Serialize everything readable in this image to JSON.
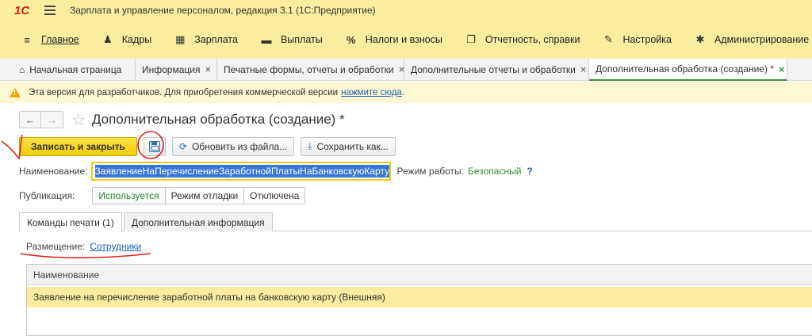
{
  "window": {
    "logo": "1С",
    "title": "Зарплата и управление персоналом, редакция 3.1  (1С:Предприятие)"
  },
  "sections": [
    {
      "icon": "menu-lines-icon",
      "glyph": "≡",
      "label": "Главное"
    },
    {
      "icon": "people-icon",
      "glyph": "♟",
      "label": "Кадры"
    },
    {
      "icon": "calculator-icon",
      "glyph": "▦",
      "label": "Зарплата"
    },
    {
      "icon": "wallet-icon",
      "glyph": "▬",
      "label": "Выплаты"
    },
    {
      "icon": "percent-icon",
      "glyph": "%",
      "label": "Налоги и взносы"
    },
    {
      "icon": "report-icon",
      "glyph": "❐",
      "label": "Отчетность, справки"
    },
    {
      "icon": "wrench-icon",
      "glyph": "✎",
      "label": "Настройка"
    },
    {
      "icon": "gear-icon",
      "glyph": "✱",
      "label": "Администрирование"
    }
  ],
  "tabs": [
    {
      "label": "Начальная страница",
      "closable": false
    },
    {
      "label": "Информация",
      "closable": true
    },
    {
      "label": "Печатные формы, отчеты и обработки",
      "closable": true
    },
    {
      "label": "Дополнительные отчеты и обработки",
      "closable": true
    },
    {
      "label": "Дополнительная обработка (создание) *",
      "closable": true
    }
  ],
  "banner": {
    "text": "Эта версия для разработчиков. Для приобретения коммерческой версии",
    "link": "нажмите сюда",
    "tail": "."
  },
  "form": {
    "title": "Дополнительная обработка (создание) *",
    "buttons": {
      "save_close": "Записать и закрыть",
      "update_from_file": "Обновить из файла...",
      "save_as": "Сохранить как..."
    },
    "name_label": "Наименование:",
    "name_value": "ЗаявлениеНаПеречислениеЗаработнойПлатыНаБанковскуюКарту (",
    "mode_label": "Режим работы:",
    "mode_value": "Безопасный",
    "help": "?",
    "publication_label": "Публикация:",
    "publication_options": [
      "Используется",
      "Режим отладки",
      "Отключена"
    ],
    "publication_selected": "Используется",
    "page_tabs": [
      "Команды печати (1)",
      "Дополнительная информация"
    ],
    "placement_label": "Размещение:",
    "placement_value": "Сотрудники",
    "table": {
      "columns": [
        "Наименование"
      ],
      "rows": [
        [
          "Заявление на перечисление заработной платы на банковскую карту (Внешняя)"
        ]
      ]
    }
  },
  "colors": {
    "sections_bg": "#fbed9e",
    "accent_green": "#2f8a3a",
    "primary_button": "#f2cb0c",
    "selection": "#3875d7",
    "annotation": "#e0201b"
  }
}
